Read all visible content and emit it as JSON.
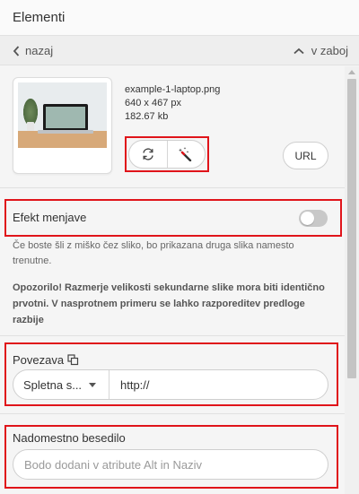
{
  "header": {
    "title": "Elementi"
  },
  "nav": {
    "back_label": "nazaj",
    "collapse_label": "v zaboj"
  },
  "image": {
    "filename": "example-1-laptop.png",
    "dimensions": "640 x 467 px",
    "filesize": "182.67 kb",
    "url_button": "URL"
  },
  "hover_effect": {
    "label": "Efekt menjave",
    "enabled": false,
    "help_text": "Če boste šli z miško čez sliko, bo prikazana druga slika namesto trenutne.",
    "warning_text": "Opozorilo! Razmerje velikosti sekundarne slike mora biti identično prvotni. V nasprotnem primeru se lahko razporeditev predloge razbije"
  },
  "link": {
    "label": "Povezava",
    "type_selected": "Spletna s...",
    "value": "http://"
  },
  "alt_text": {
    "label": "Nadomestno besedilo",
    "placeholder": "Bodo dodani v atribute Alt in Naziv"
  },
  "colors": {
    "highlight": "#e0141a",
    "toggle_off": "#c8c8c8",
    "background": "#f5f5f5"
  }
}
